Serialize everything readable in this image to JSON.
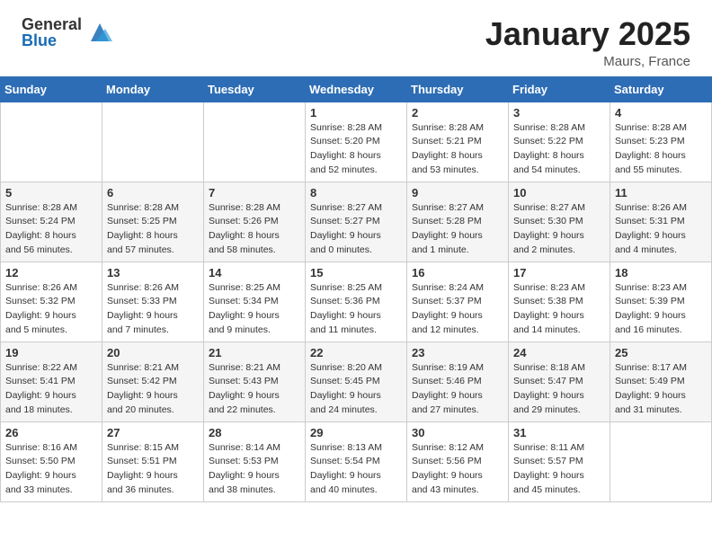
{
  "header": {
    "logo_general": "General",
    "logo_blue": "Blue",
    "month_title": "January 2025",
    "location": "Maurs, France"
  },
  "weekdays": [
    "Sunday",
    "Monday",
    "Tuesday",
    "Wednesday",
    "Thursday",
    "Friday",
    "Saturday"
  ],
  "weeks": [
    [
      {
        "day": "",
        "info": ""
      },
      {
        "day": "",
        "info": ""
      },
      {
        "day": "",
        "info": ""
      },
      {
        "day": "1",
        "info": "Sunrise: 8:28 AM\nSunset: 5:20 PM\nDaylight: 8 hours\nand 52 minutes."
      },
      {
        "day": "2",
        "info": "Sunrise: 8:28 AM\nSunset: 5:21 PM\nDaylight: 8 hours\nand 53 minutes."
      },
      {
        "day": "3",
        "info": "Sunrise: 8:28 AM\nSunset: 5:22 PM\nDaylight: 8 hours\nand 54 minutes."
      },
      {
        "day": "4",
        "info": "Sunrise: 8:28 AM\nSunset: 5:23 PM\nDaylight: 8 hours\nand 55 minutes."
      }
    ],
    [
      {
        "day": "5",
        "info": "Sunrise: 8:28 AM\nSunset: 5:24 PM\nDaylight: 8 hours\nand 56 minutes."
      },
      {
        "day": "6",
        "info": "Sunrise: 8:28 AM\nSunset: 5:25 PM\nDaylight: 8 hours\nand 57 minutes."
      },
      {
        "day": "7",
        "info": "Sunrise: 8:28 AM\nSunset: 5:26 PM\nDaylight: 8 hours\nand 58 minutes."
      },
      {
        "day": "8",
        "info": "Sunrise: 8:27 AM\nSunset: 5:27 PM\nDaylight: 9 hours\nand 0 minutes."
      },
      {
        "day": "9",
        "info": "Sunrise: 8:27 AM\nSunset: 5:28 PM\nDaylight: 9 hours\nand 1 minute."
      },
      {
        "day": "10",
        "info": "Sunrise: 8:27 AM\nSunset: 5:30 PM\nDaylight: 9 hours\nand 2 minutes."
      },
      {
        "day": "11",
        "info": "Sunrise: 8:26 AM\nSunset: 5:31 PM\nDaylight: 9 hours\nand 4 minutes."
      }
    ],
    [
      {
        "day": "12",
        "info": "Sunrise: 8:26 AM\nSunset: 5:32 PM\nDaylight: 9 hours\nand 5 minutes."
      },
      {
        "day": "13",
        "info": "Sunrise: 8:26 AM\nSunset: 5:33 PM\nDaylight: 9 hours\nand 7 minutes."
      },
      {
        "day": "14",
        "info": "Sunrise: 8:25 AM\nSunset: 5:34 PM\nDaylight: 9 hours\nand 9 minutes."
      },
      {
        "day": "15",
        "info": "Sunrise: 8:25 AM\nSunset: 5:36 PM\nDaylight: 9 hours\nand 11 minutes."
      },
      {
        "day": "16",
        "info": "Sunrise: 8:24 AM\nSunset: 5:37 PM\nDaylight: 9 hours\nand 12 minutes."
      },
      {
        "day": "17",
        "info": "Sunrise: 8:23 AM\nSunset: 5:38 PM\nDaylight: 9 hours\nand 14 minutes."
      },
      {
        "day": "18",
        "info": "Sunrise: 8:23 AM\nSunset: 5:39 PM\nDaylight: 9 hours\nand 16 minutes."
      }
    ],
    [
      {
        "day": "19",
        "info": "Sunrise: 8:22 AM\nSunset: 5:41 PM\nDaylight: 9 hours\nand 18 minutes."
      },
      {
        "day": "20",
        "info": "Sunrise: 8:21 AM\nSunset: 5:42 PM\nDaylight: 9 hours\nand 20 minutes."
      },
      {
        "day": "21",
        "info": "Sunrise: 8:21 AM\nSunset: 5:43 PM\nDaylight: 9 hours\nand 22 minutes."
      },
      {
        "day": "22",
        "info": "Sunrise: 8:20 AM\nSunset: 5:45 PM\nDaylight: 9 hours\nand 24 minutes."
      },
      {
        "day": "23",
        "info": "Sunrise: 8:19 AM\nSunset: 5:46 PM\nDaylight: 9 hours\nand 27 minutes."
      },
      {
        "day": "24",
        "info": "Sunrise: 8:18 AM\nSunset: 5:47 PM\nDaylight: 9 hours\nand 29 minutes."
      },
      {
        "day": "25",
        "info": "Sunrise: 8:17 AM\nSunset: 5:49 PM\nDaylight: 9 hours\nand 31 minutes."
      }
    ],
    [
      {
        "day": "26",
        "info": "Sunrise: 8:16 AM\nSunset: 5:50 PM\nDaylight: 9 hours\nand 33 minutes."
      },
      {
        "day": "27",
        "info": "Sunrise: 8:15 AM\nSunset: 5:51 PM\nDaylight: 9 hours\nand 36 minutes."
      },
      {
        "day": "28",
        "info": "Sunrise: 8:14 AM\nSunset: 5:53 PM\nDaylight: 9 hours\nand 38 minutes."
      },
      {
        "day": "29",
        "info": "Sunrise: 8:13 AM\nSunset: 5:54 PM\nDaylight: 9 hours\nand 40 minutes."
      },
      {
        "day": "30",
        "info": "Sunrise: 8:12 AM\nSunset: 5:56 PM\nDaylight: 9 hours\nand 43 minutes."
      },
      {
        "day": "31",
        "info": "Sunrise: 8:11 AM\nSunset: 5:57 PM\nDaylight: 9 hours\nand 45 minutes."
      },
      {
        "day": "",
        "info": ""
      }
    ]
  ]
}
